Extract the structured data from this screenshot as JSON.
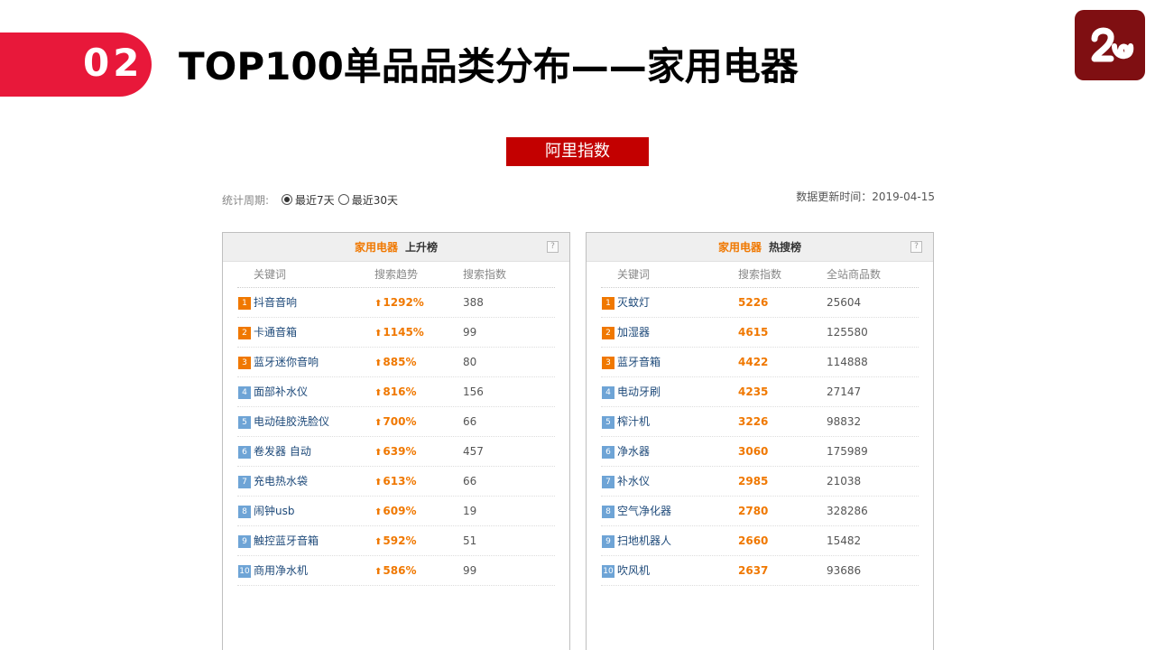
{
  "header": {
    "section_number": "02",
    "title": "TOP100单品品类分布——家用电器"
  },
  "source_banner": "阿里指数",
  "filter": {
    "period_label": "统计周期:",
    "options": [
      "最近7天",
      "最近30天"
    ],
    "selected": "最近7天",
    "update_time": "数据更新时间：2019-04-15"
  },
  "colors": {
    "accent_red": "#e8183a",
    "banner_red": "#c30000",
    "logo_bg": "#7f0f12",
    "highlight_orange": "#f07800",
    "rank_blue": "#6ea4d6"
  },
  "rising_panel": {
    "category": "家用电器",
    "kind": "上升榜",
    "help": "?",
    "columns": [
      "关键词",
      "搜索趋势",
      "搜索指数"
    ],
    "rows": [
      {
        "rank": "1",
        "keyword": "抖音音响",
        "trend": "1292%",
        "index": "388"
      },
      {
        "rank": "2",
        "keyword": "卡通音箱",
        "trend": "1145%",
        "index": "99"
      },
      {
        "rank": "3",
        "keyword": "蓝牙迷你音响",
        "trend": "885%",
        "index": "80"
      },
      {
        "rank": "4",
        "keyword": "面部补水仪",
        "trend": "816%",
        "index": "156"
      },
      {
        "rank": "5",
        "keyword": "电动硅胶洗脸仪",
        "trend": "700%",
        "index": "66"
      },
      {
        "rank": "6",
        "keyword": "卷发器 自动",
        "trend": "639%",
        "index": "457"
      },
      {
        "rank": "7",
        "keyword": "充电热水袋",
        "trend": "613%",
        "index": "66"
      },
      {
        "rank": "8",
        "keyword": "闹钟usb",
        "trend": "609%",
        "index": "19"
      },
      {
        "rank": "9",
        "keyword": "触控蓝牙音箱",
        "trend": "592%",
        "index": "51"
      },
      {
        "rank": "10",
        "keyword": "商用净水机",
        "trend": "586%",
        "index": "99"
      }
    ]
  },
  "hot_panel": {
    "category": "家用电器",
    "kind": "热搜榜",
    "help": "?",
    "columns": [
      "关键词",
      "搜索指数",
      "全站商品数"
    ],
    "rows": [
      {
        "rank": "1",
        "keyword": "灭蚊灯",
        "index": "5226",
        "products": "25604"
      },
      {
        "rank": "2",
        "keyword": "加湿器",
        "index": "4615",
        "products": "125580"
      },
      {
        "rank": "3",
        "keyword": "蓝牙音箱",
        "index": "4422",
        "products": "114888"
      },
      {
        "rank": "4",
        "keyword": "电动牙刷",
        "index": "4235",
        "products": "27147"
      },
      {
        "rank": "5",
        "keyword": "榨汁机",
        "index": "3226",
        "products": "98832"
      },
      {
        "rank": "6",
        "keyword": "净水器",
        "index": "3060",
        "products": "175989"
      },
      {
        "rank": "7",
        "keyword": "补水仪",
        "index": "2985",
        "products": "21038"
      },
      {
        "rank": "8",
        "keyword": "空气净化器",
        "index": "2780",
        "products": "328286"
      },
      {
        "rank": "9",
        "keyword": "扫地机器人",
        "index": "2660",
        "products": "15482"
      },
      {
        "rank": "10",
        "keyword": "吹风机",
        "index": "2637",
        "products": "93686"
      }
    ]
  }
}
